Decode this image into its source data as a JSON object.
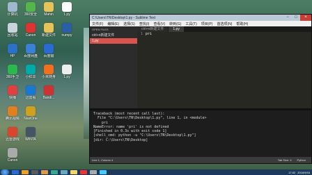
{
  "desktop_icons": [
    {
      "name": "my-computer-icon",
      "label": "计算机",
      "color": "#9fb7cf",
      "col": 0,
      "row": 0
    },
    {
      "name": "recycle-bin-icon",
      "label": "回收站",
      "color": "#c8d4db",
      "col": 0,
      "row": 1
    },
    {
      "name": "hp-icon",
      "label": "HP",
      "color": "#2a72c7",
      "col": 0,
      "row": 2
    },
    {
      "name": "360-icon",
      "label": "360手卫",
      "color": "#2db84d",
      "col": 0,
      "row": 3
    },
    {
      "name": "wifi-icon",
      "label": "快播",
      "color": "#e04040",
      "col": 0,
      "row": 4
    },
    {
      "name": "app-icon",
      "label": "腾讯视频",
      "color": "#e08020",
      "col": 0,
      "row": 5
    },
    {
      "name": "chrome-icon",
      "label": "迅雷游戏",
      "color": "#d9452d",
      "col": 0,
      "row": 6
    },
    {
      "name": "app2-icon",
      "label": "Canon",
      "color": "#aaa",
      "col": 0,
      "row": 7
    },
    {
      "name": "app3-icon",
      "label": "360安全",
      "color": "#55b54d",
      "col": 1,
      "row": 0
    },
    {
      "name": "app4-icon",
      "label": "Canon",
      "color": "#d33",
      "col": 1,
      "row": 1
    },
    {
      "name": "app5-icon",
      "label": "百度网盘",
      "color": "#3b7fd6",
      "col": 1,
      "row": 2
    },
    {
      "name": "app6-icon",
      "label": "小红伞",
      "color": "#0aa",
      "col": 1,
      "row": 3
    },
    {
      "name": "app7-icon",
      "label": "迅雷看",
      "color": "#1b78d0",
      "col": 1,
      "row": 4
    },
    {
      "name": "app8-icon",
      "label": "NaviOne",
      "color": "#d0a020",
      "col": 1,
      "row": 5
    },
    {
      "name": "app9-icon",
      "label": "WINTA",
      "color": "#456",
      "col": 1,
      "row": 6
    },
    {
      "name": "folder-icon",
      "label": "Mahin",
      "color": "#e5c35a",
      "col": 2,
      "row": 0
    },
    {
      "name": "folder2-icon",
      "label": "新建文件",
      "color": "#e5c35a",
      "col": 2,
      "row": 1
    },
    {
      "name": "app10-icon",
      "label": "百度输",
      "color": "#2a6bd1",
      "col": 2,
      "row": 2
    },
    {
      "name": "app11-icon",
      "label": "小米随身",
      "color": "#f07020",
      "col": 2,
      "row": 3
    },
    {
      "name": "app12-icon",
      "label": "Bandi...",
      "color": "#c33",
      "col": 2,
      "row": 4
    },
    {
      "name": "py-file-icon",
      "label": "1.py",
      "color": "#fff",
      "col": 3,
      "row": 0
    },
    {
      "name": "word-icon",
      "label": "numpy",
      "color": "#2b5ea7",
      "col": 3,
      "row": 1
    },
    {
      "name": "file-icon",
      "label": "1.py",
      "color": "#eee",
      "col": 3,
      "row": 3
    }
  ],
  "window": {
    "title": "C:\\Users\\TN\\Desktop\\1.py - Sublime Text",
    "menu": [
      "文件(F)",
      "编辑(E)",
      "选择(S)",
      "查找(I)",
      "查看(V)",
      "转到(G)",
      "工具(T)",
      "项目(P)",
      "首选项(N)",
      "帮助(H)"
    ],
    "sidebar_header": "OPEN FILES",
    "sidebar_items": [
      {
        "label": "ctrl+n新建文件",
        "active": false
      },
      {
        "label": "1.py",
        "active": true
      }
    ],
    "tabs": [
      {
        "label": "ctrl+n新建文件",
        "active": false
      },
      {
        "label": "1.py",
        "active": true
      }
    ],
    "line_numbers": [
      "1"
    ],
    "code_lines": [
      "pri"
    ],
    "console_lines": [
      "Traceback (most recent call last):",
      "  File \"C:\\Users\\TN\\Desktop\\1.py\", line 1, in <module>",
      "    pri",
      "NameError: name 'pri' is not defined",
      "[Finished in 0.3s with exit code 1]",
      "[shell_cmd: python -u \"C:\\Users\\TN\\Desktop\\1.py\"]",
      "[dir: C:\\Users\\TN\\Desktop]"
    ],
    "status_left": "Line 1, Column 4",
    "status_right": [
      "Tab Size: 4",
      "Python"
    ]
  },
  "taskbar": {
    "items": [
      "#2a6bd1",
      "#f0a020",
      "#5a5a5a",
      "#d94",
      "#3a8",
      "#6ab",
      "#f7d560",
      "#e33",
      "#aaa",
      "#4cf"
    ],
    "clock": "17:02",
    "date": "2016/9/16"
  }
}
